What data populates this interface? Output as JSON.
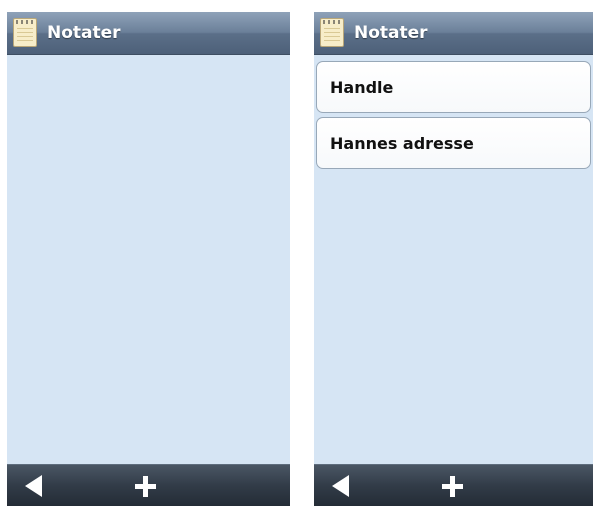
{
  "screens": [
    {
      "title": "Notater",
      "notes": []
    },
    {
      "title": "Notater",
      "notes": [
        {
          "label": "Handle"
        },
        {
          "label": "Hannes adresse"
        }
      ]
    }
  ],
  "icons": {
    "app": "notepad-icon",
    "back": "back-arrow-icon",
    "add": "plus-icon"
  },
  "colors": {
    "background": "#d6e5f4",
    "titlebar": "#6b8099",
    "bottombar": "#323c48",
    "note_text": "#111111"
  }
}
